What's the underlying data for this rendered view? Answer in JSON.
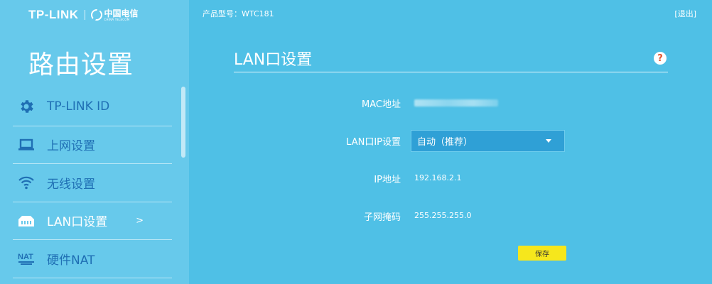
{
  "brand": {
    "tplink": "TP-LINK",
    "telecom_cn": "中国电信",
    "telecom_en": "CHINA TELECOM"
  },
  "header": {
    "model": "产品型号：WTC181",
    "logout": "[退出]"
  },
  "sidebar": {
    "title": "路由设置",
    "items": [
      {
        "label": "TP-LINK ID",
        "icon": "gear-icon"
      },
      {
        "label": "上网设置",
        "icon": "laptop-icon"
      },
      {
        "label": "无线设置",
        "icon": "wifi-icon"
      },
      {
        "label": "LAN口设置",
        "icon": "lan-port-icon",
        "active": true,
        "arrow": ">"
      },
      {
        "label": "硬件NAT",
        "icon": "nat-icon"
      }
    ]
  },
  "main": {
    "title": "LAN口设置",
    "help": "?",
    "fields": {
      "mac_label": "MAC地址",
      "lan_ip_label": "LAN口IP设置",
      "lan_ip_value": "自动（推荐）",
      "ip_label": "IP地址",
      "ip_value": "192.168.2.1",
      "mask_label": "子网掩码",
      "mask_value": "255.255.255.0"
    },
    "save_label": "保存"
  },
  "colors": {
    "background": "#4fc0e6",
    "sidebar": "#67c9eb",
    "select": "#2fa0d6",
    "button": "#f6e71c",
    "icon_blue": "#1f6fb4",
    "help_red": "#e2552f"
  }
}
